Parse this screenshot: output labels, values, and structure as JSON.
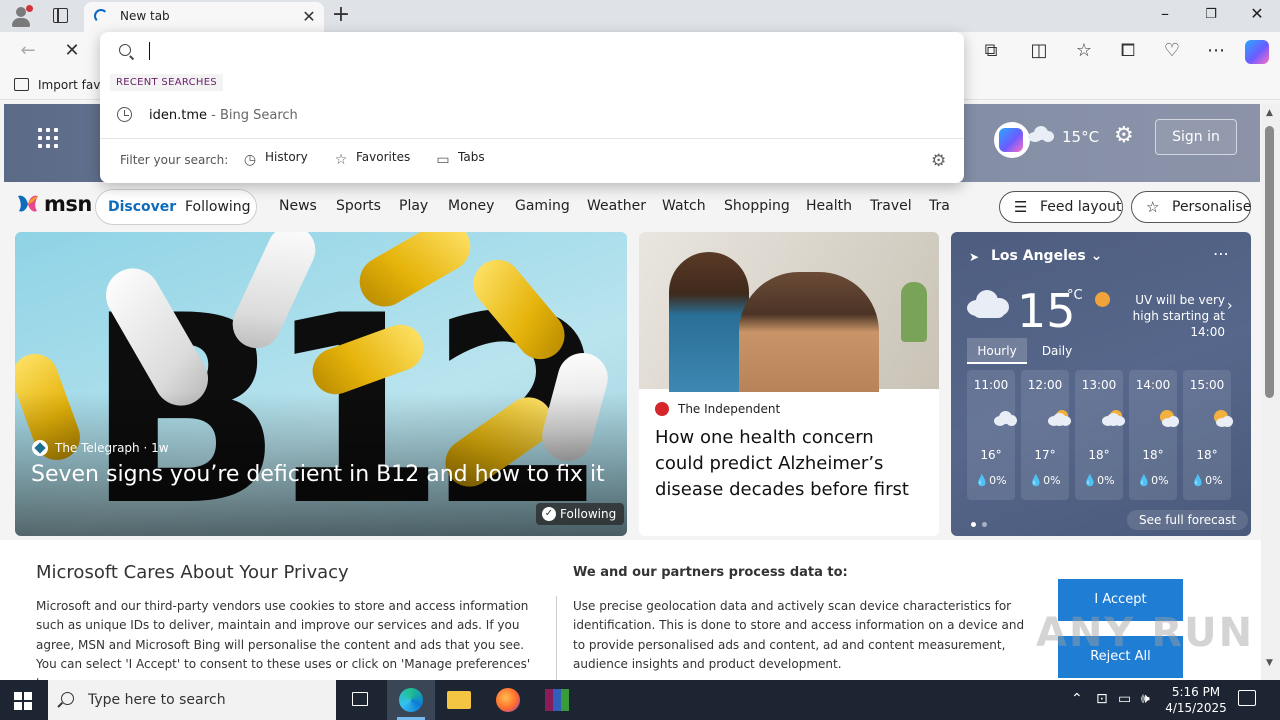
{
  "browser": {
    "tab_title": "New tab",
    "favbar_item": "Import favo"
  },
  "omnibox": {
    "input_value": "",
    "recent_label": "RECENT SEARCHES",
    "suggestion": {
      "main": "iden.tme",
      "sub": " - Bing Search"
    },
    "filter_label": "Filter your search:",
    "filters": [
      "History",
      "Favorites",
      "Tabs"
    ]
  },
  "msn": {
    "header": {
      "temp": "15°C",
      "signin": "Sign in"
    },
    "logo": "msn",
    "pills": [
      "Discover",
      "Following"
    ],
    "nav": [
      "News",
      "Sports",
      "Play",
      "Money",
      "Gaming",
      "Weather",
      "Watch",
      "Shopping",
      "Health",
      "Travel",
      "Tra"
    ],
    "feed_layout": "Feed layout",
    "personalise": "Personalise",
    "main_card": {
      "image_text": "B12",
      "source": "The Telegraph",
      "age": " · 1w",
      "headline": "Seven signs you’re deficient in B12 and how to fix it",
      "follow": "Following"
    },
    "second_card": {
      "source": "The Independent",
      "headline": "How one health concern could predict Alzheimer’s disease decades before first symptoms"
    },
    "weather": {
      "location": "Los Angeles",
      "temp": "15",
      "unit": "°C",
      "uv": "UV will be very high starting at 14:00",
      "tabs": [
        "Hourly",
        "Daily"
      ],
      "hours": [
        {
          "time": "11:00",
          "temp": "16°",
          "precip": "0%"
        },
        {
          "time": "12:00",
          "temp": "17°",
          "precip": "0%"
        },
        {
          "time": "13:00",
          "temp": "18°",
          "precip": "0%"
        },
        {
          "time": "14:00",
          "temp": "18°",
          "precip": "0%"
        },
        {
          "time": "15:00",
          "temp": "18°",
          "precip": "0%"
        }
      ],
      "forecast": "See full forecast"
    },
    "privacy": {
      "title": "Microsoft Cares About Your Privacy",
      "body": "Microsoft and our third-party vendors use cookies to store and access information such as unique IDs to deliver, maintain and improve our services and ads. If you agree, MSN and Microsoft Bing will personalise the content and ads that you see. You can select 'I Accept' to consent to these uses or click on 'Manage preferences' to",
      "title2": "We and our partners process data to:",
      "body2": "Use precise geolocation data and actively scan device characteristics for identification. This is done to store and access information on a device and to provide personalised ads and content, ad and content measurement, audience insights and product development.",
      "accept": "I Accept",
      "reject": "Reject All",
      "watermark": "ANY RUN"
    }
  },
  "taskbar": {
    "search_placeholder": "Type here to search",
    "time": "5:16 PM",
    "date": "4/15/2025"
  }
}
